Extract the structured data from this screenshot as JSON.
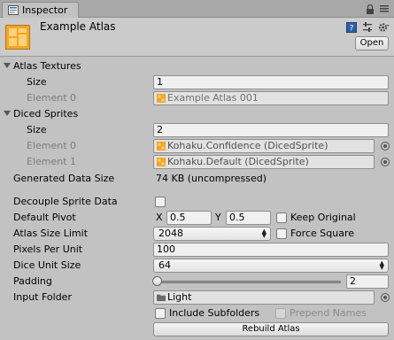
{
  "tab": {
    "label": "Inspector"
  },
  "header": {
    "title": "Example Atlas",
    "open_label": "Open"
  },
  "atlas_textures": {
    "label": "Atlas Textures",
    "size_label": "Size",
    "size_value": "1",
    "element0_label": "Element 0",
    "element0_value": "Example Atlas 001"
  },
  "diced_sprites": {
    "label": "Diced Sprites",
    "size_label": "Size",
    "size_value": "2",
    "element0_label": "Element 0",
    "element0_value": "Kohaku.Confidence (DicedSprite)",
    "element1_label": "Element 1",
    "element1_value": "Kohaku.Default (DicedSprite)"
  },
  "generated": {
    "label": "Generated Data Size",
    "value": "74 KB (uncompressed)"
  },
  "decouple": {
    "label": "Decouple Sprite Data",
    "checked": false
  },
  "pivot": {
    "label": "Default Pivot",
    "x_label": "X",
    "x_value": "0.5",
    "y_label": "Y",
    "y_value": "0.5",
    "keep_original_label": "Keep Original"
  },
  "atlas_size": {
    "label": "Atlas Size Limit",
    "value": "2048",
    "force_square_label": "Force Square"
  },
  "ppu": {
    "label": "Pixels Per Unit",
    "value": "100"
  },
  "dice_unit": {
    "label": "Dice Unit Size",
    "value": "64"
  },
  "padding": {
    "label": "Padding",
    "value": "2"
  },
  "input_folder": {
    "label": "Input Folder",
    "value": "Light",
    "include_subfolders_label": "Include Subfolders",
    "prepend_names_label": "Prepend Names"
  },
  "rebuild": {
    "label": "Rebuild Atlas"
  },
  "colors": {
    "panel": "#c2c2c2",
    "icon_orange": "#f5a623",
    "icon_blue": "#2f5fa8"
  }
}
